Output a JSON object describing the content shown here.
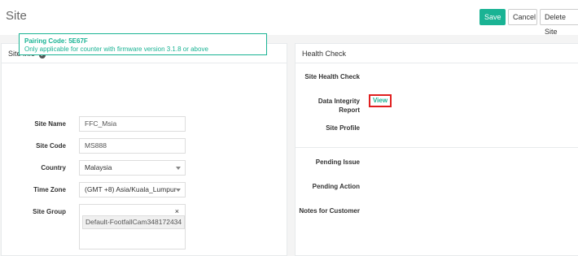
{
  "page": {
    "title": "Site"
  },
  "toolbar": {
    "save": "Save",
    "cancel": "Cancel",
    "delete": "Delete Site"
  },
  "site_info": {
    "title": "Site Info",
    "pairing_code_label": "Pairing Code: 5E67F",
    "pairing_note": "Only applicable for counter with firmware version 3.1.8 or above",
    "fields": {
      "site_name": {
        "label": "Site Name",
        "value": "FFC_Msia"
      },
      "site_code": {
        "label": "Site Code",
        "value": "MS888"
      },
      "country": {
        "label": "Country",
        "value": "Malaysia"
      },
      "time_zone": {
        "label": "Time Zone",
        "value": "(GMT +8) Asia/Kuala_Lumpur"
      },
      "site_group": {
        "label": "Site Group",
        "tag": "Default-FootfallCam348172434",
        "clear": "×"
      }
    }
  },
  "health_check": {
    "title": "Health Check",
    "site_health_check": "Site Health Check",
    "data_integrity_line1": "Data Integrity",
    "data_integrity_line2": "Report",
    "view_link": "View",
    "site_profile": "Site Profile",
    "pending_issue": "Pending Issue",
    "pending_action": "Pending Action",
    "notes_for_customer": "Notes for Customer"
  },
  "colors": {
    "accent": "#1ab394",
    "highlight": "#e02020"
  }
}
